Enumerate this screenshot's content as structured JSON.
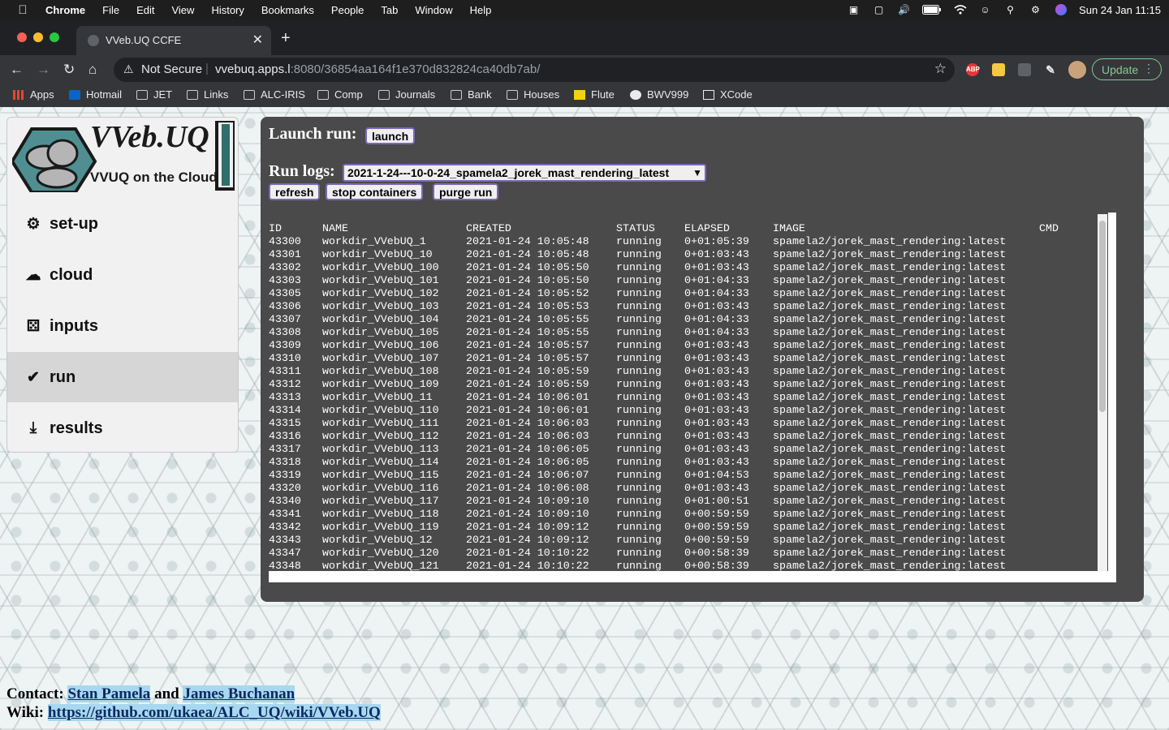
{
  "menubar": {
    "app": "Chrome",
    "items": [
      "File",
      "Edit",
      "View",
      "History",
      "Bookmarks",
      "People",
      "Tab",
      "Window",
      "Help"
    ],
    "datetime": "Sun 24 Jan  11:15"
  },
  "browser": {
    "tab_title": "VVeb.UQ CCFE",
    "security_label": "Not Secure",
    "url_host": "vvebuq.apps.l",
    "url_rest": ":8080/36854aa164f1e370d832824ca40db7ab/",
    "update_label": "Update",
    "ext_abp": "ABP"
  },
  "bookmarks": [
    "Apps",
    "Hotmail",
    "JET",
    "Links",
    "ALC-IRIS",
    "Comp",
    "Journals",
    "Bank",
    "Houses",
    "Flute",
    "BWV999",
    "XCode"
  ],
  "logo": {
    "title": "VVeb.UQ",
    "subtitle": "VVUQ on the Cloud"
  },
  "sidebar": {
    "items": [
      {
        "label": "set-up"
      },
      {
        "label": "cloud"
      },
      {
        "label": "inputs"
      },
      {
        "label": "run"
      },
      {
        "label": "results"
      }
    ],
    "active": "run"
  },
  "panel": {
    "launch_label": "Launch run:",
    "launch_button": "launch",
    "runlogs_label": "Run logs:",
    "selected_run": "2021-1-24---10-0-24_spamela2_jorek_mast_rendering_latest",
    "refresh_button": "refresh",
    "stop_button": "stop containers",
    "purge_button": "purge run"
  },
  "log": {
    "headers": [
      "ID",
      "NAME",
      "CREATED",
      "STATUS",
      "ELAPSED",
      "IMAGE",
      "CMD"
    ],
    "rows": [
      [
        "43300",
        "workdir_VVebUQ_1",
        "2021-01-24 10:05:48",
        "running",
        "0+01:05:39",
        "spamela2/jorek_mast_rendering:latest"
      ],
      [
        "43301",
        "workdir_VVebUQ_10",
        "2021-01-24 10:05:48",
        "running",
        "0+01:03:43",
        "spamela2/jorek_mast_rendering:latest"
      ],
      [
        "43302",
        "workdir_VVebUQ_100",
        "2021-01-24 10:05:50",
        "running",
        "0+01:03:43",
        "spamela2/jorek_mast_rendering:latest"
      ],
      [
        "43303",
        "workdir_VVebUQ_101",
        "2021-01-24 10:05:50",
        "running",
        "0+01:04:33",
        "spamela2/jorek_mast_rendering:latest"
      ],
      [
        "43305",
        "workdir_VVebUQ_102",
        "2021-01-24 10:05:52",
        "running",
        "0+01:04:33",
        "spamela2/jorek_mast_rendering:latest"
      ],
      [
        "43306",
        "workdir_VVebUQ_103",
        "2021-01-24 10:05:53",
        "running",
        "0+01:03:43",
        "spamela2/jorek_mast_rendering:latest"
      ],
      [
        "43307",
        "workdir_VVebUQ_104",
        "2021-01-24 10:05:55",
        "running",
        "0+01:04:33",
        "spamela2/jorek_mast_rendering:latest"
      ],
      [
        "43308",
        "workdir_VVebUQ_105",
        "2021-01-24 10:05:55",
        "running",
        "0+01:04:33",
        "spamela2/jorek_mast_rendering:latest"
      ],
      [
        "43309",
        "workdir_VVebUQ_106",
        "2021-01-24 10:05:57",
        "running",
        "0+01:03:43",
        "spamela2/jorek_mast_rendering:latest"
      ],
      [
        "43310",
        "workdir_VVebUQ_107",
        "2021-01-24 10:05:57",
        "running",
        "0+01:03:43",
        "spamela2/jorek_mast_rendering:latest"
      ],
      [
        "43311",
        "workdir_VVebUQ_108",
        "2021-01-24 10:05:59",
        "running",
        "0+01:03:43",
        "spamela2/jorek_mast_rendering:latest"
      ],
      [
        "43312",
        "workdir_VVebUQ_109",
        "2021-01-24 10:05:59",
        "running",
        "0+01:03:43",
        "spamela2/jorek_mast_rendering:latest"
      ],
      [
        "43313",
        "workdir_VVebUQ_11",
        "2021-01-24 10:06:01",
        "running",
        "0+01:03:43",
        "spamela2/jorek_mast_rendering:latest"
      ],
      [
        "43314",
        "workdir_VVebUQ_110",
        "2021-01-24 10:06:01",
        "running",
        "0+01:03:43",
        "spamela2/jorek_mast_rendering:latest"
      ],
      [
        "43315",
        "workdir_VVebUQ_111",
        "2021-01-24 10:06:03",
        "running",
        "0+01:03:43",
        "spamela2/jorek_mast_rendering:latest"
      ],
      [
        "43316",
        "workdir_VVebUQ_112",
        "2021-01-24 10:06:03",
        "running",
        "0+01:03:43",
        "spamela2/jorek_mast_rendering:latest"
      ],
      [
        "43317",
        "workdir_VVebUQ_113",
        "2021-01-24 10:06:05",
        "running",
        "0+01:03:43",
        "spamela2/jorek_mast_rendering:latest"
      ],
      [
        "43318",
        "workdir_VVebUQ_114",
        "2021-01-24 10:06:05",
        "running",
        "0+01:03:43",
        "spamela2/jorek_mast_rendering:latest"
      ],
      [
        "43319",
        "workdir_VVebUQ_115",
        "2021-01-24 10:06:07",
        "running",
        "0+01:04:53",
        "spamela2/jorek_mast_rendering:latest"
      ],
      [
        "43320",
        "workdir_VVebUQ_116",
        "2021-01-24 10:06:08",
        "running",
        "0+01:03:43",
        "spamela2/jorek_mast_rendering:latest"
      ],
      [
        "43340",
        "workdir_VVebUQ_117",
        "2021-01-24 10:09:10",
        "running",
        "0+01:00:51",
        "spamela2/jorek_mast_rendering:latest"
      ],
      [
        "43341",
        "workdir_VVebUQ_118",
        "2021-01-24 10:09:10",
        "running",
        "0+00:59:59",
        "spamela2/jorek_mast_rendering:latest"
      ],
      [
        "43342",
        "workdir_VVebUQ_119",
        "2021-01-24 10:09:12",
        "running",
        "0+00:59:59",
        "spamela2/jorek_mast_rendering:latest"
      ],
      [
        "43343",
        "workdir_VVebUQ_12",
        "2021-01-24 10:09:12",
        "running",
        "0+00:59:59",
        "spamela2/jorek_mast_rendering:latest"
      ],
      [
        "43347",
        "workdir_VVebUQ_120",
        "2021-01-24 10:10:22",
        "running",
        "0+00:58:39",
        "spamela2/jorek_mast_rendering:latest"
      ],
      [
        "43348",
        "workdir_VVebUQ_121",
        "2021-01-24 10:10:22",
        "running",
        "0+00:58:39",
        "spamela2/jorek_mast_rendering:latest"
      ]
    ]
  },
  "footer": {
    "contact_label": "Contact:",
    "contact1": "Stan Pamela",
    "and": "and",
    "contact2": "James Buchanan",
    "wiki_label": "Wiki:",
    "wiki_link": "https://github.com/ukaea/ALC_UQ/wiki/VVeb.UQ"
  },
  "colors": {
    "panel_bg": "#4a4a4a",
    "button_border": "#7b68b8",
    "update_green": "#81c995",
    "link_highlight": "#a8d8ef",
    "active_menu_bg": "#d6d6d6"
  }
}
